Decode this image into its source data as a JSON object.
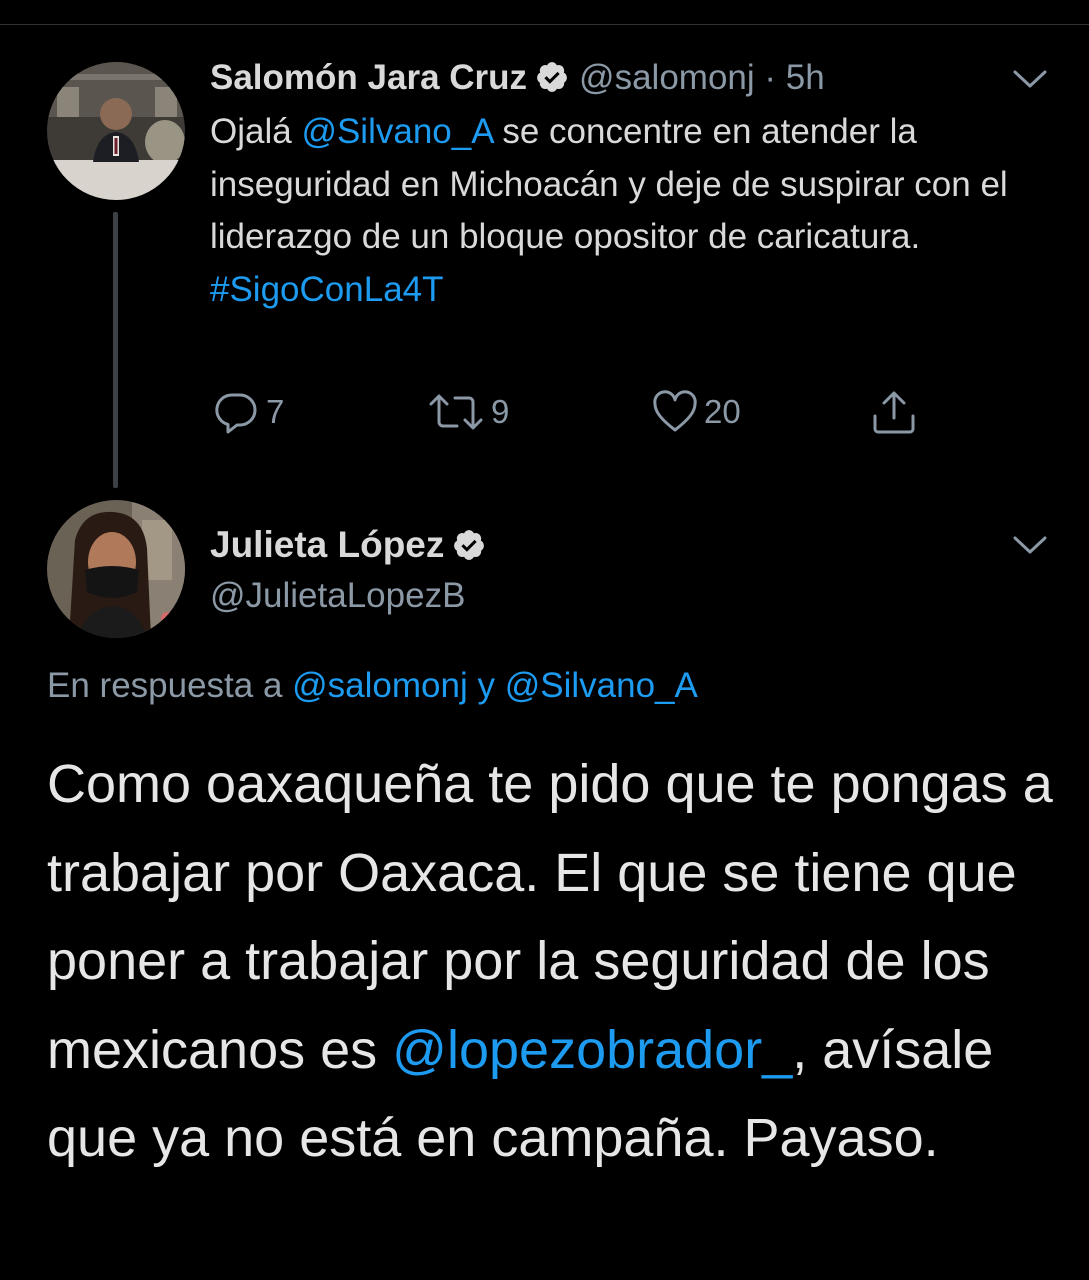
{
  "tweet1": {
    "author_name": "Salomón Jara Cruz",
    "handle": "@salomonj",
    "separator": " · ",
    "time": "5h",
    "avatar_icon": "profile-photo",
    "verified_icon": "verified-badge",
    "menu_icon": "chevron-down",
    "text_intro": "Ojalá ",
    "mention": "@Silvano_A",
    "text_body": " se concentre en atender la inseguridad en Michoacán y deje de suspirar con el liderazgo de un bloque opositor de caricatura.",
    "hashtag": "#SigoConLa4T",
    "actions": {
      "replies": "7",
      "retweets": "9",
      "likes": "20"
    }
  },
  "tweet2": {
    "author_name": "Julieta López",
    "handle": "@JulietaLopezB",
    "avatar_icon": "profile-photo",
    "verified_icon": "verified-badge",
    "menu_icon": "chevron-down",
    "reply_prefix": "En respuesta a ",
    "reply_mention1": "@salomonj",
    "reply_and": " y ",
    "reply_mention2": "@Silvano_A",
    "text_part1": "Como oaxaqueña te pido que te pongas a trabajar por Oaxaca. El que se tiene que poner a trabajar por la seguridad de los mexicanos es ",
    "text_mention": "@lopezobrador_",
    "text_part2": ", avísale que ya no está en campaña. Payaso."
  },
  "colors": {
    "background": "#000000",
    "text": "#d9d9d9",
    "secondary": "#8b98a5",
    "link": "#1d9bf0",
    "thread_line": "#3d4145"
  }
}
